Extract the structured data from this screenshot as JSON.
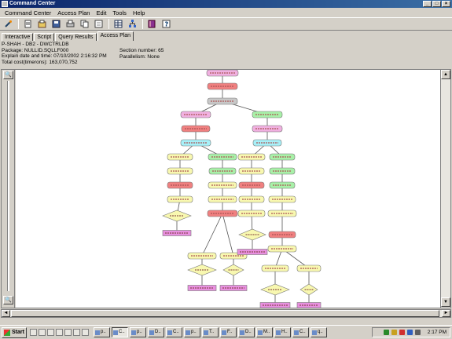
{
  "window": {
    "title": "Command Center"
  },
  "menu": [
    "Command Center",
    "Access Plan",
    "Edit",
    "Tools",
    "Help"
  ],
  "tabs": [
    {
      "label": "Interactive",
      "active": false
    },
    {
      "label": "Script",
      "active": false
    },
    {
      "label": "Query Results",
      "active": false
    },
    {
      "label": "Access Plan",
      "active": true
    }
  ],
  "info": {
    "line1": "P-SHAH - DB2 - DWCTRLDB",
    "line2": "Package: NULLID.SQLLF000",
    "line3": "Explain date and time: 07/10/2002 2:16:32 PM",
    "line4": "Total cost(timerons): 163,070,752",
    "section": "Section number: 65",
    "parallelism": "Parallelism: None"
  },
  "toolbar": [
    "wand-icon",
    "script-icon",
    "open-icon",
    "save-icon",
    "print-icon",
    "copy-icon",
    "paste-icon",
    "table-icon",
    "tree-icon",
    "book-icon",
    "help-icon"
  ],
  "taskbar": {
    "start": "Start",
    "buttons": [
      "p..",
      "C..",
      "p..",
      "D..",
      "C..",
      "p..",
      "T..",
      "F..",
      "D..",
      "M..",
      "H..",
      "C..",
      "q.."
    ],
    "clock": "2:17 PM"
  },
  "colors": {
    "pink": "#f0b0e0",
    "red": "#f08080",
    "gray": "#c8c8c8",
    "green": "#a8f0a8",
    "cyan": "#a8f0f8",
    "yellow": "#f8f8b0",
    "magenta": "#e890e0"
  }
}
